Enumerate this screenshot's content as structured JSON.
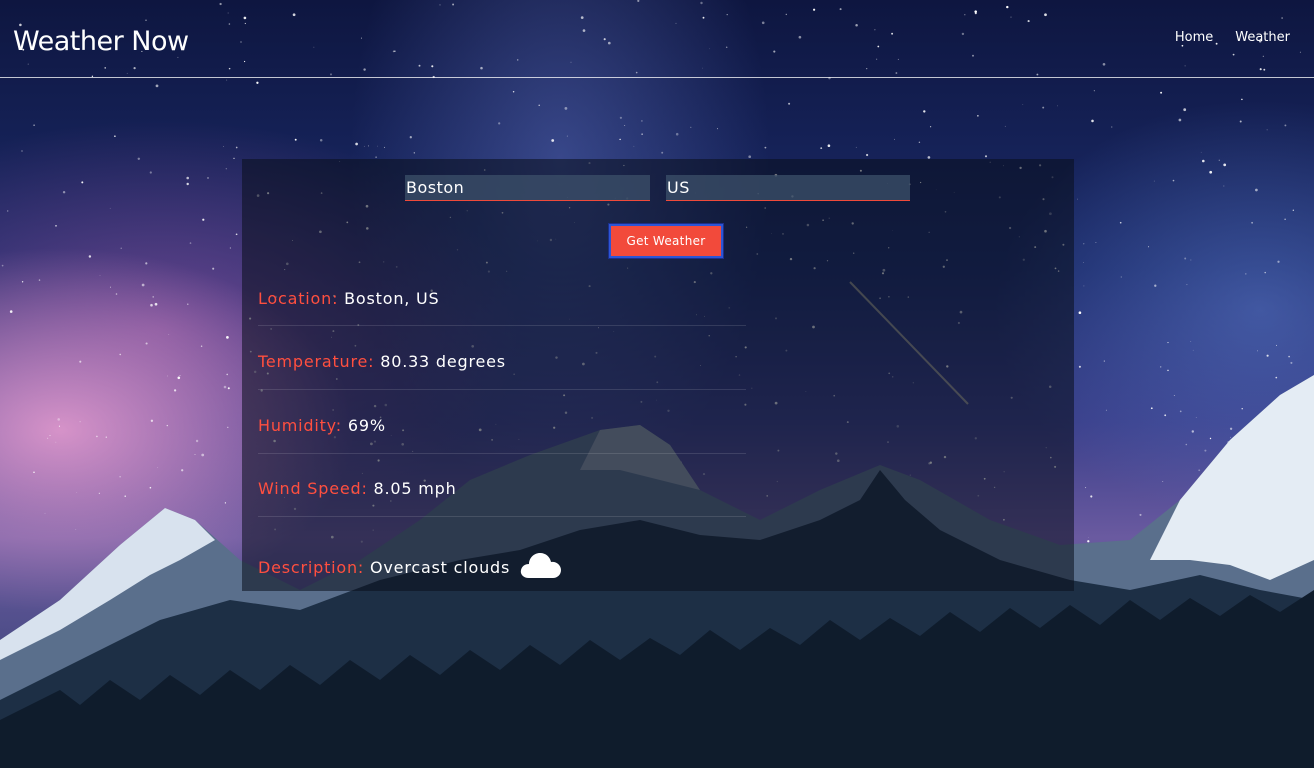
{
  "header": {
    "title": "Weather Now",
    "nav": [
      {
        "label": "Home"
      },
      {
        "label": "Weather"
      }
    ]
  },
  "form": {
    "city_value": "Boston",
    "country_value": "US",
    "submit_label": "Get Weather"
  },
  "results": {
    "location": {
      "label": "Location:",
      "value": "Boston, US"
    },
    "temperature": {
      "label": "Temperature:",
      "value": "80.33 degrees"
    },
    "humidity": {
      "label": "Humidity:",
      "value": "69%"
    },
    "wind": {
      "label": "Wind Speed:",
      "value": "8.05 mph"
    },
    "description": {
      "label": "Description:",
      "value": "Overcast clouds",
      "icon": "cloud-icon"
    }
  },
  "colors": {
    "accent": "#f24a3b",
    "label": "#ff4f3f",
    "button_border": "#2c55d6"
  }
}
